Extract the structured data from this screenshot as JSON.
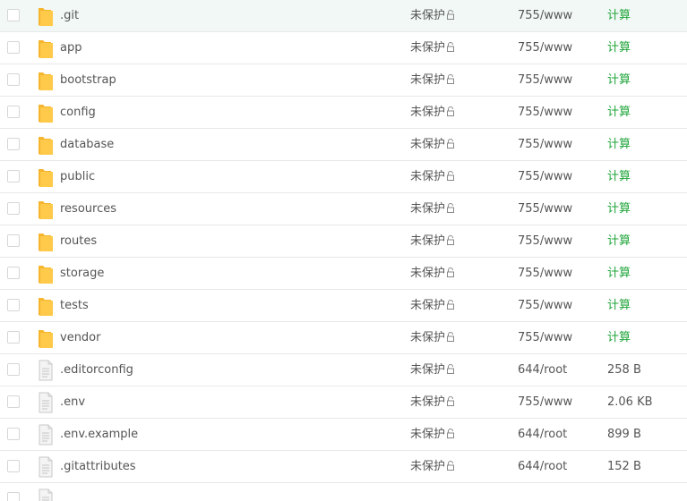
{
  "colors": {
    "folder": "#ffc94a",
    "folder_dark": "#f5b52e",
    "link_green": "#20a53a",
    "row_hover": "#f2f8f6",
    "border": "#e8e8e8"
  },
  "rows": [
    {
      "name": ".git",
      "type": "folder",
      "protect": "未保护",
      "perm": "755/www",
      "size": "计算",
      "calc": true,
      "hover": true
    },
    {
      "name": "app",
      "type": "folder",
      "protect": "未保护",
      "perm": "755/www",
      "size": "计算",
      "calc": true
    },
    {
      "name": "bootstrap",
      "type": "folder",
      "protect": "未保护",
      "perm": "755/www",
      "size": "计算",
      "calc": true
    },
    {
      "name": "config",
      "type": "folder",
      "protect": "未保护",
      "perm": "755/www",
      "size": "计算",
      "calc": true
    },
    {
      "name": "database",
      "type": "folder",
      "protect": "未保护",
      "perm": "755/www",
      "size": "计算",
      "calc": true
    },
    {
      "name": "public",
      "type": "folder",
      "protect": "未保护",
      "perm": "755/www",
      "size": "计算",
      "calc": true
    },
    {
      "name": "resources",
      "type": "folder",
      "protect": "未保护",
      "perm": "755/www",
      "size": "计算",
      "calc": true
    },
    {
      "name": "routes",
      "type": "folder",
      "protect": "未保护",
      "perm": "755/www",
      "size": "计算",
      "calc": true
    },
    {
      "name": "storage",
      "type": "folder",
      "protect": "未保护",
      "perm": "755/www",
      "size": "计算",
      "calc": true
    },
    {
      "name": "tests",
      "type": "folder",
      "protect": "未保护",
      "perm": "755/www",
      "size": "计算",
      "calc": true
    },
    {
      "name": "vendor",
      "type": "folder",
      "protect": "未保护",
      "perm": "755/www",
      "size": "计算",
      "calc": true
    },
    {
      "name": ".editorconfig",
      "type": "file",
      "protect": "未保护",
      "perm": "644/root",
      "size": "258 B",
      "calc": false
    },
    {
      "name": ".env",
      "type": "file",
      "protect": "未保护",
      "perm": "755/www",
      "size": "2.06 KB",
      "calc": false
    },
    {
      "name": ".env.example",
      "type": "file",
      "protect": "未保护",
      "perm": "644/root",
      "size": "899 B",
      "calc": false
    },
    {
      "name": ".gitattributes",
      "type": "file",
      "protect": "未保护",
      "perm": "644/root",
      "size": "152 B",
      "calc": false
    },
    {
      "name": "",
      "type": "file",
      "protect": "",
      "perm": "",
      "size": "",
      "calc": false
    }
  ],
  "icons": {
    "folder": "folder-icon",
    "file": "file-icon",
    "lock": "unlock-icon"
  }
}
